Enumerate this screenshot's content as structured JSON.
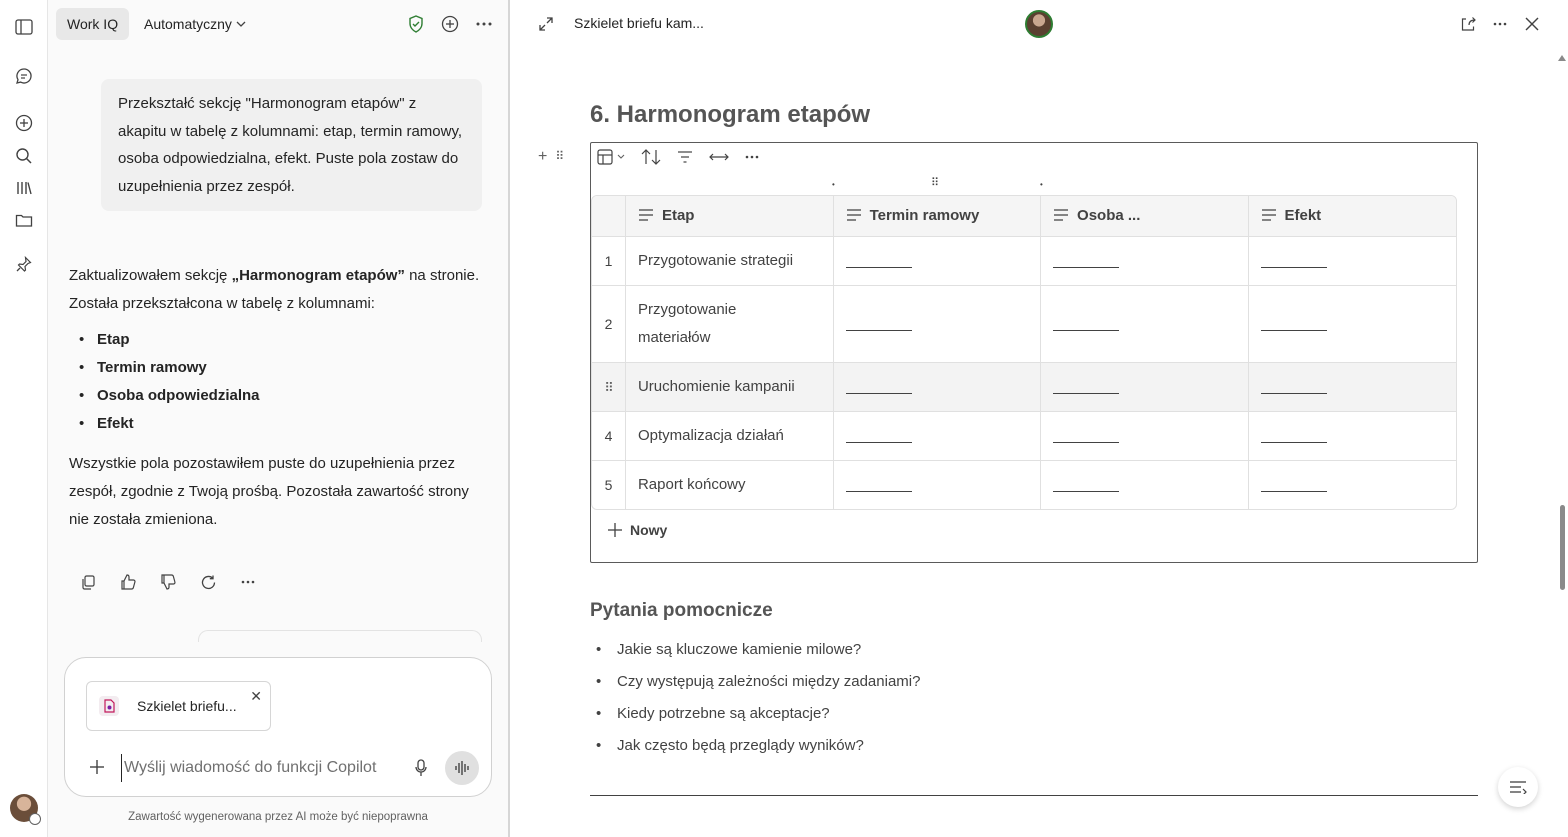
{
  "chat": {
    "brand_pill": "Work IQ",
    "mode_label": "Automatyczny",
    "user_message": "Przekształć sekcję \"Harmonogram etapów\" z akapitu w tabelę z kolumnami: etap, termin ramowy, osoba odpowiedzialna, efekt. Puste pola zostaw do uzupełnienia przez zespół.",
    "response": {
      "intro_before": "Zaktualizowałem sekcję ",
      "intro_bold": "„Harmonogram etapów”",
      "intro_after": " na stronie. Została przekształcona w tabelę z kolumnami:",
      "bullets": [
        "Etap",
        "Termin ramowy",
        "Osoba odpowiedzialna",
        "Efekt"
      ],
      "closing": "Wszystkie pola pozostawiłem puste do uzupełnienia przez zespół, zgodnie z Twoją prośbą. Pozostała zawartość strony nie została zmieniona."
    },
    "composer": {
      "attachment_label": "Szkielet briefu...",
      "placeholder": "Wyślij wiadomość do funkcji Copilot"
    },
    "disclaimer": "Zawartość wygenerowana przez AI może być niepoprawna"
  },
  "page": {
    "tab_title": "Szkielet briefu kam...",
    "section_heading": "6. Harmonogram etapów",
    "table": {
      "headers": [
        "Etap",
        "Termin ramowy",
        "Osoba ...",
        "Efekt"
      ],
      "rows": [
        {
          "num": "1",
          "etap_l1": "Przygotowanie strategii",
          "etap_l2": ""
        },
        {
          "num": "2",
          "etap_l1": "Przygotowanie",
          "etap_l2": "materiałów"
        },
        {
          "num": "",
          "etap_l1": "Uruchomienie kampanii",
          "etap_l2": ""
        },
        {
          "num": "4",
          "etap_l1": "Optymalizacja działań",
          "etap_l2": ""
        },
        {
          "num": "5",
          "etap_l1": "Raport końcowy",
          "etap_l2": ""
        }
      ],
      "new_row_label": "Nowy"
    },
    "help_heading": "Pytania pomocnicze",
    "questions": [
      "Jakie są kluczowe kamienie milowe?",
      "Czy występują zależności między zadaniami?",
      "Kiedy potrzebne są akceptacje?",
      "Jak często będą przeglądy wyników?"
    ]
  },
  "colors": {
    "accent_green": "#2e7d32",
    "text_primary": "#242424",
    "border": "#e0e0e0"
  }
}
